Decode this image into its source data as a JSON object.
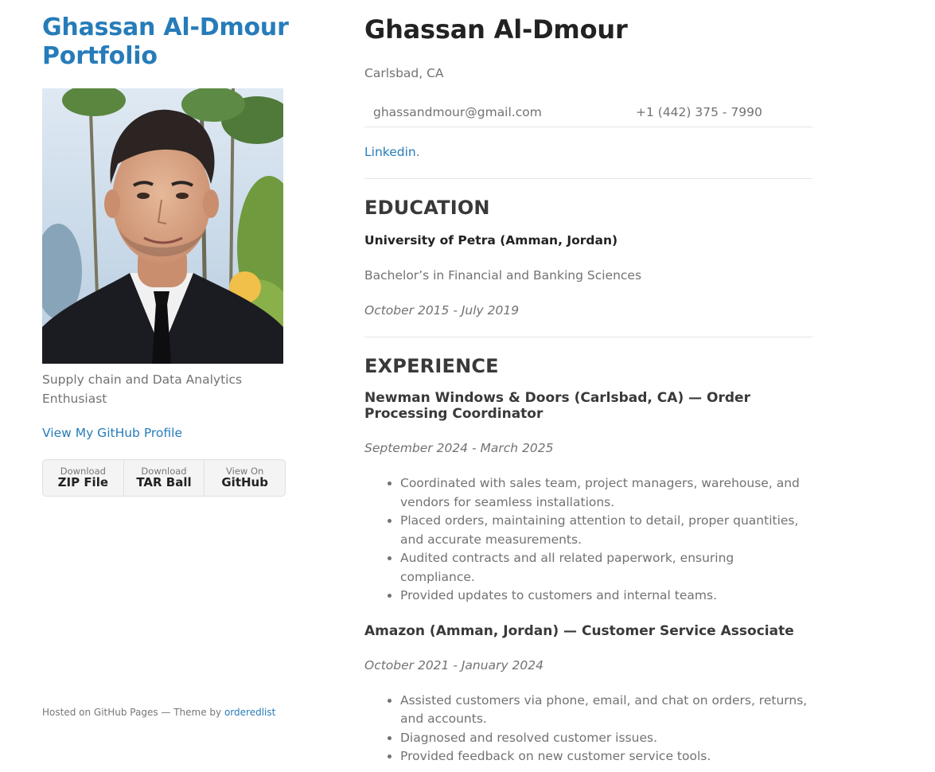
{
  "sidebar": {
    "title_line1": "Ghassan Al-Dmour",
    "title_line2": "Portfolio",
    "tagline": "Supply chain and Data Analytics Enthusiast",
    "github_link": "View My GitHub Profile",
    "downloads": [
      {
        "small": "Download",
        "big": "ZIP File"
      },
      {
        "small": "Download",
        "big": "TAR Ball"
      },
      {
        "small": "View On",
        "big": "GitHub"
      }
    ],
    "footer_text": "Hosted on GitHub Pages — Theme by ",
    "footer_link": "orderedlist"
  },
  "main": {
    "name": "Ghassan Al-Dmour",
    "location": "Carlsbad, CA",
    "email": "ghassandmour@gmail.com",
    "phone": "+1 (442) 375 - 7990",
    "linkedin_label": "Linkedin",
    "linkedin_suffix": ".",
    "education": {
      "heading": "EDUCATION",
      "school": "University of Petra (Amman, Jordan)",
      "degree": "Bachelor’s in Financial and Banking Sciences",
      "dates": "October 2015 - July 2019"
    },
    "experience": {
      "heading": "EXPERIENCE",
      "jobs": [
        {
          "title": "Newman Windows & Doors (Carlsbad, CA) — Order Processing Coordinator",
          "dates": "September 2024 - March 2025",
          "bullets": [
            "Coordinated with sales team, project managers, warehouse, and vendors for seamless installations.",
            "Placed orders, maintaining attention to detail, proper quantities, and accurate measurements.",
            "Audited contracts and all related paperwork, ensuring compliance.",
            "Provided updates to customers and internal teams."
          ]
        },
        {
          "title": "Amazon (Amman, Jordan) — Customer Service Associate",
          "dates": "October 2021 - January 2024",
          "bullets": [
            "Assisted customers via phone, email, and chat on orders, returns, and accounts.",
            "Diagnosed and resolved customer issues.",
            "Provided feedback on new customer service tools."
          ]
        }
      ]
    }
  }
}
